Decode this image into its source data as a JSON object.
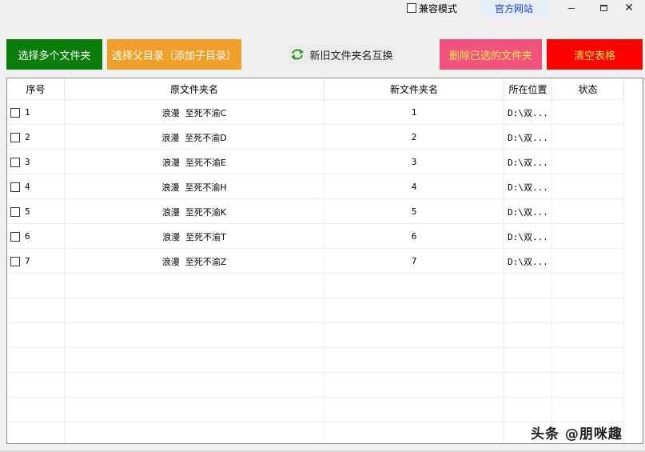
{
  "titlebar": {
    "compat_label": "兼容模式",
    "site_label": "官方网站",
    "minimize": "–",
    "maximize": "□",
    "close": "✕"
  },
  "toolbar": {
    "select_multi": "选择多个文件夹",
    "select_parent": "选择父目录（添加子目录）",
    "swap_names": "新旧文件夹名互换",
    "delete_selected": "删除已选的文件夹",
    "clear_table": "清空表格"
  },
  "table": {
    "headers": [
      "序号",
      "原文件夹名",
      "新文件夹名",
      "所在位置",
      "状态"
    ],
    "rows": [
      {
        "no": "1",
        "original": "浪漫  至死不渝C",
        "new": "1",
        "location": "D:\\双...",
        "status": ""
      },
      {
        "no": "2",
        "original": "浪漫  至死不渝D",
        "new": "2",
        "location": "D:\\双...",
        "status": ""
      },
      {
        "no": "3",
        "original": "浪漫  至死不渝E",
        "new": "3",
        "location": "D:\\双...",
        "status": ""
      },
      {
        "no": "4",
        "original": "浪漫  至死不渝H",
        "new": "4",
        "location": "D:\\双...",
        "status": ""
      },
      {
        "no": "5",
        "original": "浪漫  至死不渝K",
        "new": "5",
        "location": "D:\\双...",
        "status": ""
      },
      {
        "no": "6",
        "original": "浪漫  至死不渝T",
        "new": "6",
        "location": "D:\\双...",
        "status": ""
      },
      {
        "no": "7",
        "original": "浪漫  至死不渝Z",
        "new": "7",
        "location": "D:\\双...",
        "status": ""
      }
    ]
  },
  "watermark": "头条 @朋咪趣"
}
